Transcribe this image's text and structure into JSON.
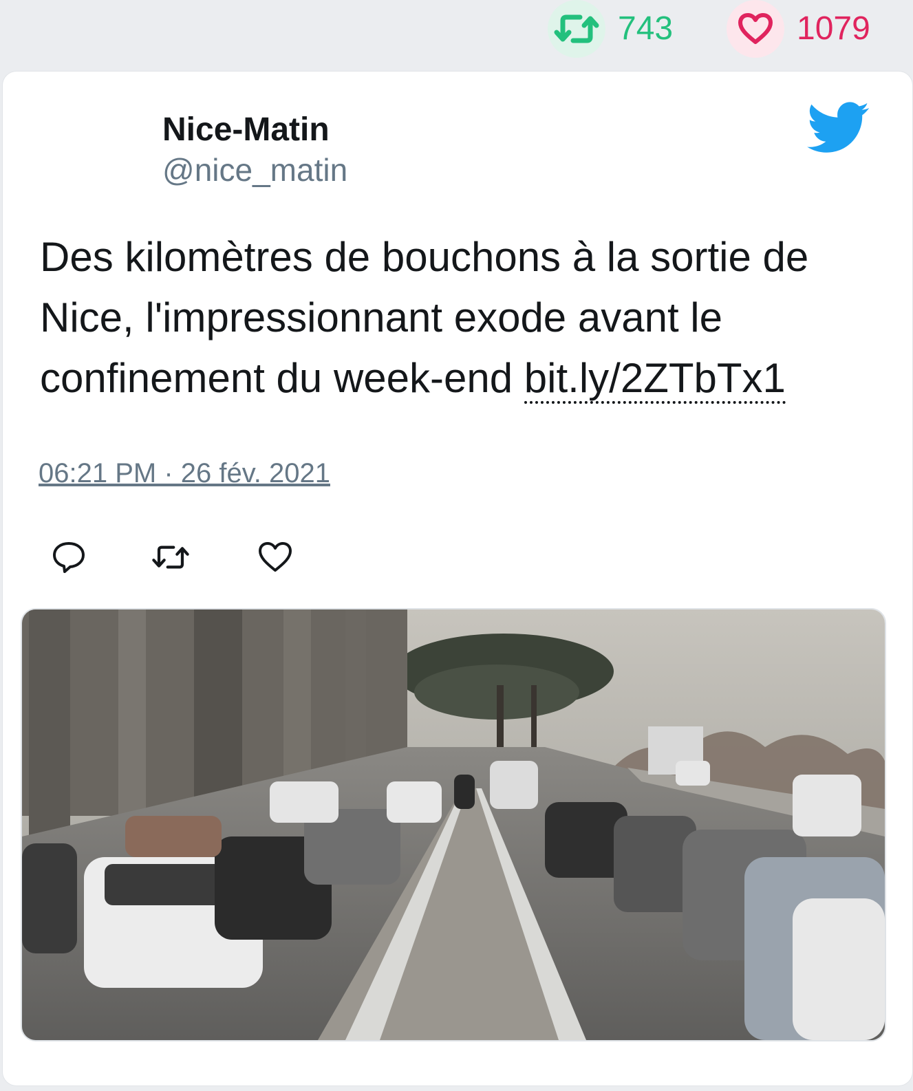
{
  "stats": {
    "retweets": "743",
    "likes": "1079"
  },
  "author": {
    "name": "Nice-Matin",
    "handle": "@nice_matin"
  },
  "tweet": {
    "text": "Des kilomètres de bouchons à la sortie de Nice, l'impressionnant exode avant le confinement du week-end ",
    "link": "bit.ly/2ZTbTx1",
    "timestamp": "06:21 PM · 26 fév. 2021"
  },
  "icons": {
    "retweet": "retweet-icon",
    "like": "heart-icon",
    "reply": "reply-icon",
    "brand": "twitter-bird-icon"
  },
  "colors": {
    "retweet": "#23c07d",
    "like": "#e0245e",
    "twitter": "#1da1f2",
    "muted": "#657786"
  }
}
